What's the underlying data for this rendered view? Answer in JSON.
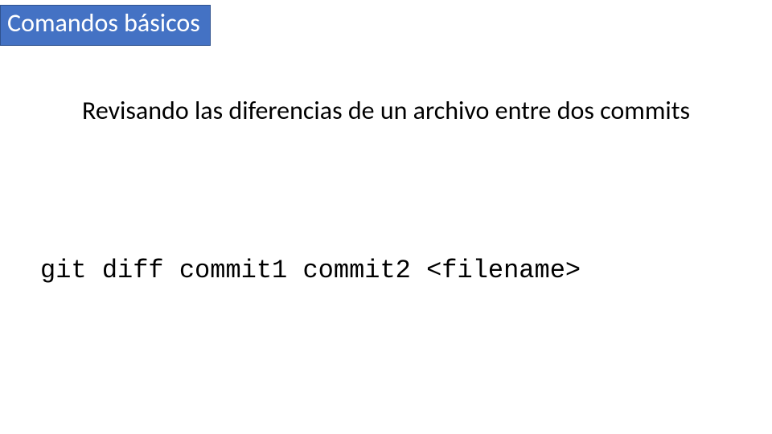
{
  "header": {
    "title": "Comandos básicos"
  },
  "body": {
    "subtitle": "Revisando las diferencias de un archivo entre dos commits",
    "command": "git diff commit1 commit2 <filename>"
  }
}
